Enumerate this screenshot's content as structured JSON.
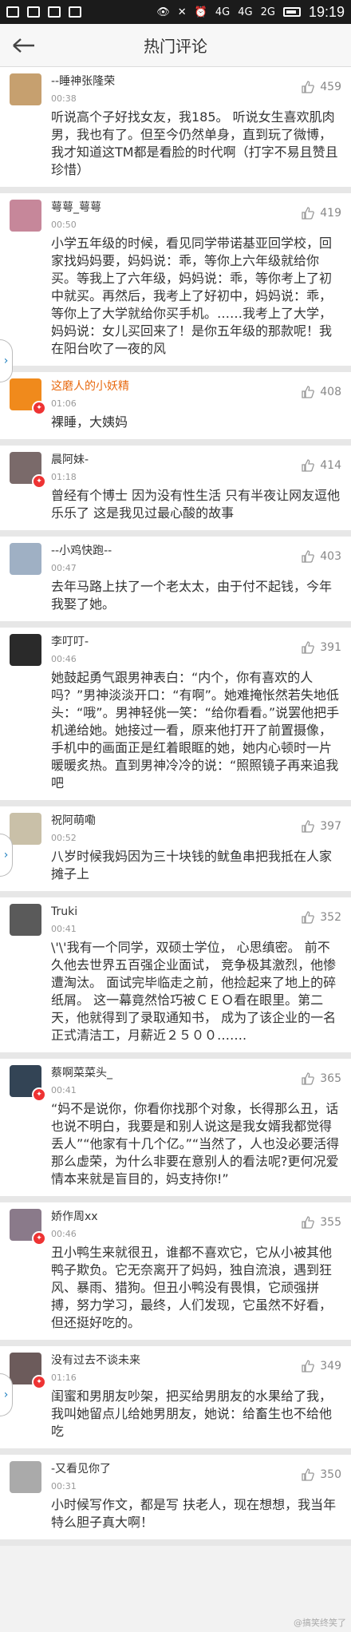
{
  "status": {
    "network": "4G",
    "network2": "4G",
    "network3": "2G",
    "time": "19:19"
  },
  "header": {
    "title": "热门评论",
    "back_icon": "back-arrow-icon"
  },
  "colors": {
    "accent_orange": "#e86a10",
    "link_blue": "#1d7fbf"
  },
  "comments": [
    {
      "name": "--睡神张隆荣",
      "time": "00:38",
      "likes": "459",
      "text": "听说高个子好找女友，我185。 听说女生喜欢肌肉男，我也有了。但至今仍然单身，直到玩了微博，我才知道这TM都是看脸的时代啊（打字不易且赞且珍惜）"
    },
    {
      "name": "萼萼_萼萼",
      "time": "00:50",
      "likes": "419",
      "text": "小学五年级的时候，看见同学带诺基亚回学校，回家找妈妈要，妈妈说：乖，等你上六年级就给你买。等我上了六年级，妈妈说：乖，等你考上了初中就买。再然后，我考上了好初中，妈妈说：乖，等你上了大学就给你买手机。……我考上了大学，妈妈说：女儿买回来了！是你五年级的那款呢！我在阳台吹了一夜的风"
    },
    {
      "name": "这磨人的小妖精",
      "time": "01:06",
      "likes": "408",
      "text": "裸睡，大姨妈"
    },
    {
      "name": "晨阿妹-",
      "time": "01:18",
      "likes": "414",
      "text": "曾经有个博士 因为没有性生活 只有半夜让网友逗他乐乐了 这是我见过最心酸的故事"
    },
    {
      "name": "--小鸡快跑--",
      "time": "00:47",
      "likes": "403",
      "text": "去年马路上扶了一个老太太，由于付不起钱，今年我娶了她。"
    },
    {
      "name": "李叮叮-",
      "time": "00:46",
      "likes": "391",
      "text": "她鼓起勇气跟男神表白：“内个，你有喜欢的人吗？”男神淡淡开口：“有啊”。她难掩怅然若失地低头：“哦”。男神轻佻一笑：“给你看看。”说罢他把手机递给她。她接过一看，原来他打开了前置摄像，手机中的画面正是红着眼眶的她，她内心顿时一片暖暖炙热。直到男神冷冷的说：“照照镜子再来追我吧"
    },
    {
      "name": "祝阿萌嘞",
      "time": "00:52",
      "likes": "397",
      "text": "八岁时候我妈因为三十块钱的鱿鱼串把我抵在人家摊子上"
    },
    {
      "name": "Truki",
      "time": "00:41",
      "likes": "352",
      "text": "\\'\\'我有一个同学，双硕士学位， 心思缜密。 前不久他去世界五百强企业面试， 竞争极其激烈，他惨遭淘汰。 面试完毕临走之前，他捡起来了地上的碎纸屑。 这一幕竟然恰巧被ＣＥＯ看在眼里。第二天，他就得到了录取通知书， 成为了该企业的一名正式清洁工，月薪近２５００……."
    },
    {
      "name": "蔡啊菜菜头_",
      "time": "00:41",
      "likes": "365",
      "text": "“妈不是说你，你看你找那个对象，长得那么丑，话也说不明白，我要是和别人说这是我女婿我都觉得丢人”“他家有十几个亿。”“当然了，人也没必要活得那么虚荣，为什么非要在意别人的看法呢?更何况爱情本来就是盲目的，妈支持你!”"
    },
    {
      "name": "娇作周xx",
      "time": "00:46",
      "likes": "355",
      "text": "丑小鸭生来就很丑，谁都不喜欢它，它从小被其他鸭子欺负。它无奈离开了妈妈，独自流浪，遇到狂风、暴雨、猎狗。但丑小鸭没有畏惧，它顽强拼搏，努力学习，最终，人们发现，它虽然不好看，但还挺好吃的。"
    },
    {
      "name": "没有过去不谈未来",
      "time": "01:16",
      "likes": "349",
      "text": "闺蜜和男朋友吵架，把买给男朋友的水果给了我，我叫她留点儿给她男朋友，她说：给畜生也不给他吃"
    },
    {
      "name": "-又看见你了",
      "time": "00:31",
      "likes": "350",
      "text": "小时候写作文，都是写 扶老人，现在想想，我当年特么胆子真大啊！"
    }
  ],
  "watermark": "@搞笑终笑了"
}
